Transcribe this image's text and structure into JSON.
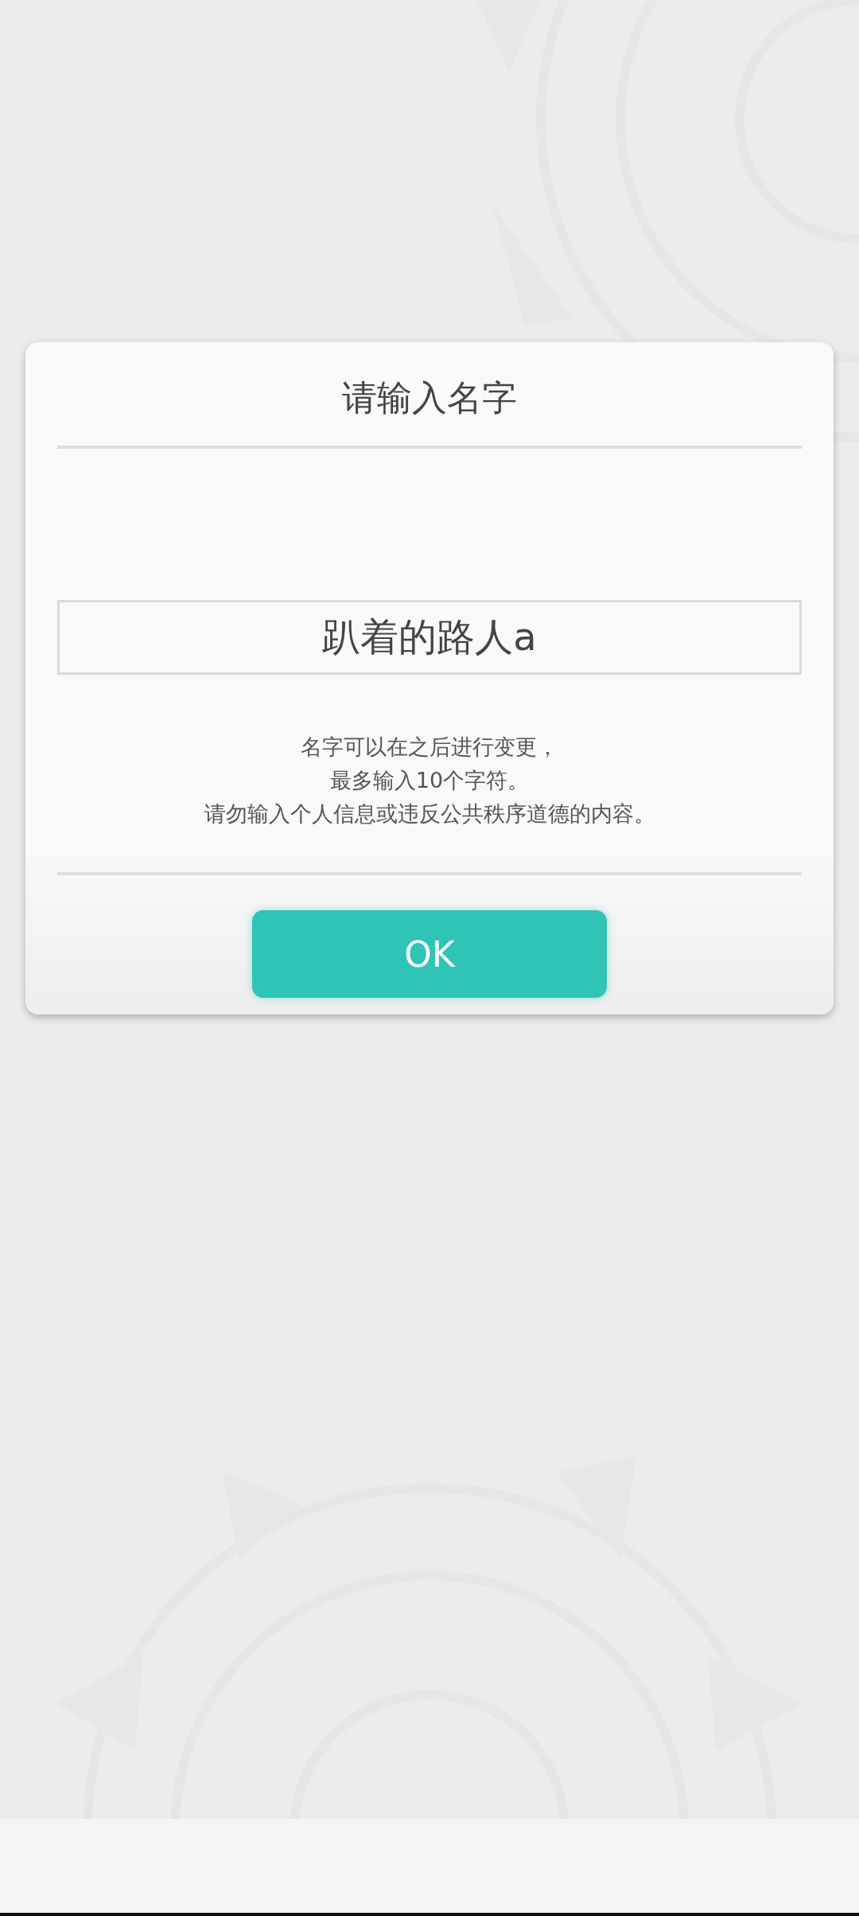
{
  "dialog": {
    "title": "请输入名字",
    "name_field": {
      "value": "趴着的路人a"
    },
    "notes": [
      "名字可以在之后进行变更，",
      "最多输入10个字符。",
      "请勿输入个人信息或违反公共秩序道德的内容。"
    ],
    "ok_button": {
      "label": "OK"
    }
  }
}
